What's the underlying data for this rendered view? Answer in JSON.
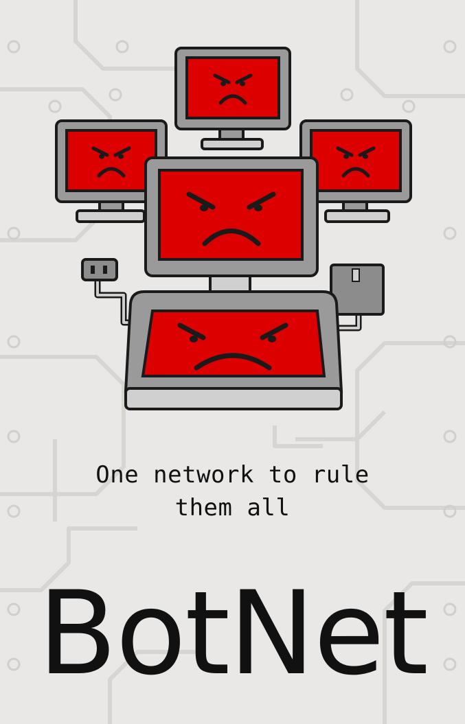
{
  "poster": {
    "tagline_line1": "One network to rule",
    "tagline_line2": "them all",
    "title": "BotNet"
  },
  "colors": {
    "background": "#e9e8e6",
    "screen_red": "#dd0000",
    "frame_gray": "#9a9a9a",
    "outline": "#1a1a1a",
    "text": "#111111"
  },
  "icons": [
    "angry-monitor-icon",
    "angry-laptop-icon",
    "power-plug-icon",
    "floppy-disk-icon"
  ]
}
